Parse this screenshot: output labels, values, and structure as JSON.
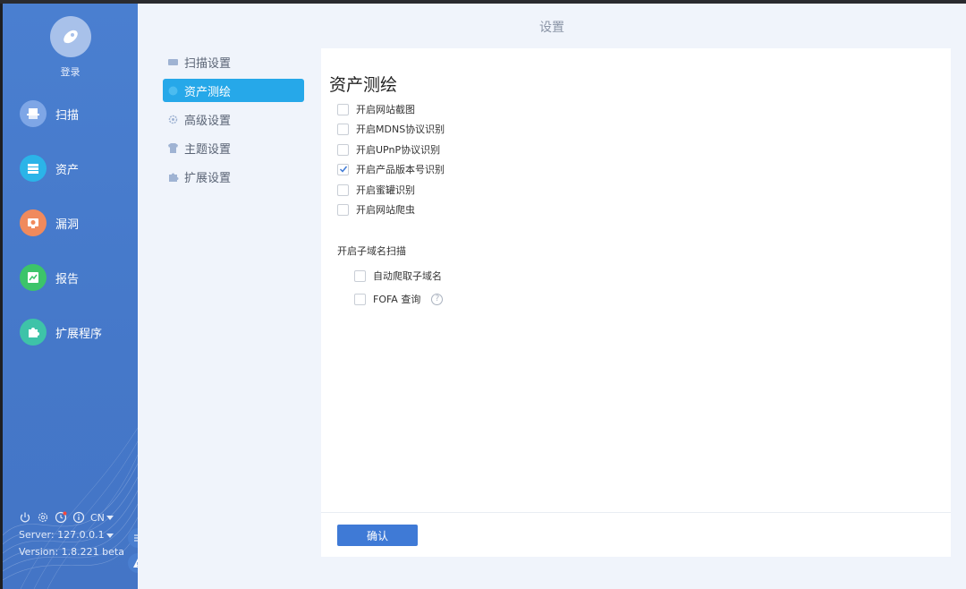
{
  "sidebar": {
    "login_label": "登录",
    "items": [
      {
        "label": "扫描",
        "icon": "scan-icon",
        "color": "#7ea6e6"
      },
      {
        "label": "资产",
        "icon": "asset-icon",
        "color": "#2bb4e8"
      },
      {
        "label": "漏洞",
        "icon": "vuln-icon",
        "color": "#f08a5d"
      },
      {
        "label": "报告",
        "icon": "report-icon",
        "color": "#3cc46a"
      },
      {
        "label": "扩展程序",
        "icon": "extension-icon",
        "color": "#3ec3a8"
      }
    ],
    "footer": {
      "lang": "CN",
      "server": "Server: 127.0.0.1",
      "version": "Version: 1.8.221 beta"
    }
  },
  "page_title": "设置",
  "submenu": [
    {
      "label": "扫描设置",
      "icon": "scan-settings-icon",
      "active": false
    },
    {
      "label": "资产测绘",
      "icon": "asset-mapping-icon",
      "active": true
    },
    {
      "label": "高级设置",
      "icon": "advanced-settings-icon",
      "active": false
    },
    {
      "label": "主题设置",
      "icon": "theme-settings-icon",
      "active": false
    },
    {
      "label": "扩展设置",
      "icon": "extension-settings-icon",
      "active": false
    }
  ],
  "panel": {
    "title": "资产测绘",
    "options": [
      {
        "label": "开启网站截图",
        "checked": false
      },
      {
        "label": "开启MDNS协议识别",
        "checked": false
      },
      {
        "label": "开启UPnP协议识别",
        "checked": false
      },
      {
        "label": "开启产品版本号识别",
        "checked": true
      },
      {
        "label": "开启蜜罐识别",
        "checked": false
      },
      {
        "label": "开启网站爬虫",
        "checked": false
      }
    ],
    "subdomain_section": "开启子域名扫描",
    "subdomain_options": [
      {
        "label": "自动爬取子域名",
        "checked": false
      },
      {
        "label": "FOFA 查询",
        "checked": false
      }
    ],
    "confirm_label": "确认"
  },
  "colors": {
    "sidebar": "#4a7fd0",
    "active_tab": "#26a8e9",
    "confirm": "#3f7ad6",
    "check": "#3f7ad6"
  }
}
